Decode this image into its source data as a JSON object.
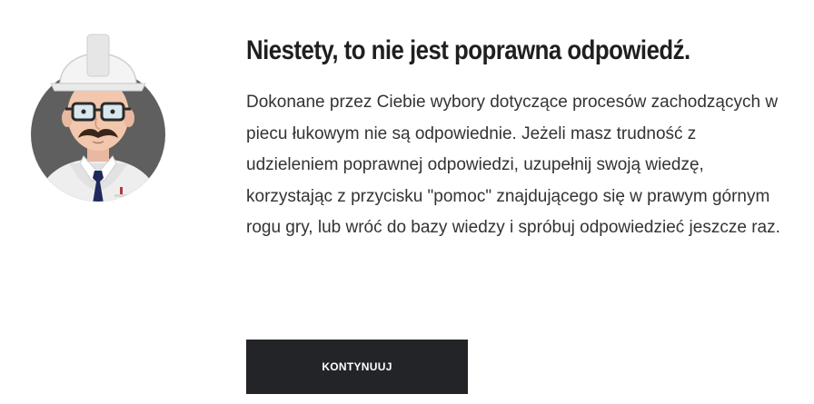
{
  "feedback": {
    "title": "Niestety, to nie jest poprawna odpowiedź.",
    "message": "Dokonane przez Ciebie wybory dotyczące procesów zachodzących w piecu łukowym nie są odpowiednie. Jeżeli masz trudność z udzieleniem poprawnej odpowiedzi, uzupełnij swoją wiedzę, korzystając z przycisku \"pomoc\" znajdującego się w prawym górnym rogu gry, lub wróć do bazy wiedzy i spróbuj odpowiedzieć jeszcze raz.",
    "continue_label": "KONTYNUUJ"
  },
  "avatar": {
    "icon": "engineer-avatar-icon"
  },
  "colors": {
    "button_bg": "#222428",
    "title_text": "#1f1f21",
    "body_text": "#333333",
    "avatar_circle": "#5f5f5f"
  }
}
